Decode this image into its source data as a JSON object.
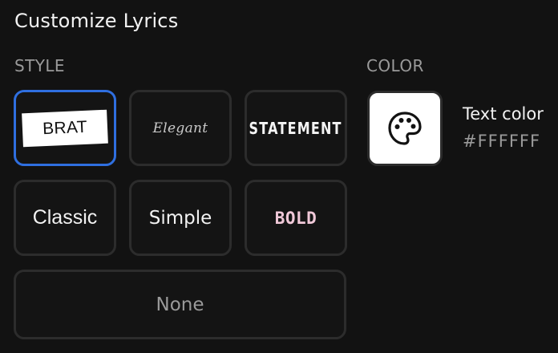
{
  "header": {
    "title": "Customize Lyrics"
  },
  "style_section": {
    "label": "STYLE",
    "options": [
      {
        "id": "brat",
        "label": "BRAT",
        "selected": true
      },
      {
        "id": "elegant",
        "label": "Elegant",
        "selected": false
      },
      {
        "id": "statement",
        "label": "STATEMENT",
        "selected": false
      },
      {
        "id": "classic",
        "label": "Classic",
        "selected": false
      },
      {
        "id": "simple",
        "label": "Simple",
        "selected": false
      },
      {
        "id": "bold",
        "label": "BOLD",
        "selected": false
      },
      {
        "id": "none",
        "label": "None",
        "selected": false
      }
    ]
  },
  "color_section": {
    "label": "COLOR",
    "swatch_icon": "palette-icon",
    "swatch_color": "#FFFFFF",
    "name": "Text color",
    "value": "#FFFFFF"
  },
  "colors": {
    "accent": "#2F6FE0",
    "background": "#121212",
    "bold_style_text": "#F0C8D8"
  }
}
